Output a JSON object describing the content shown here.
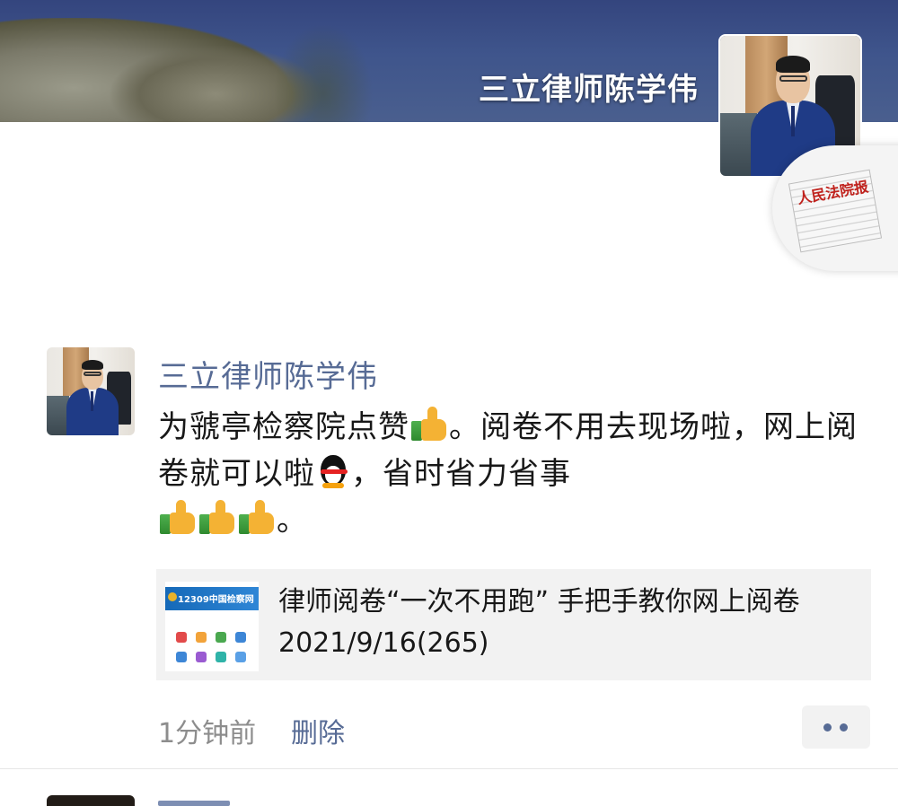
{
  "cover": {
    "display_name": "三立律师陈学伟"
  },
  "badge": {
    "paper_title": "人民法院报"
  },
  "post": {
    "author": "三立律师陈学伟",
    "text_parts": {
      "p1": "为虢亭检察院点赞",
      "p2": "。阅卷不用去现场啦，网上阅卷就可以啦",
      "p3": "，省时省力省事",
      "p4": "。"
    },
    "emoji": [
      "thumbs-up",
      "penguin",
      "thumbs-up",
      "thumbs-up",
      "thumbs-up"
    ],
    "share": {
      "thumb_banner": "12309中国检察网",
      "title": "律师阅卷“一次不用跑” 手把手教你网上阅卷 2021/9/16(265)"
    },
    "time": "1分钟前",
    "delete_label": "删除"
  },
  "colors": {
    "link_blue": "#576b95",
    "text": "#181818",
    "meta_gray": "#8d8d8d",
    "card_bg": "#f2f2f2"
  }
}
